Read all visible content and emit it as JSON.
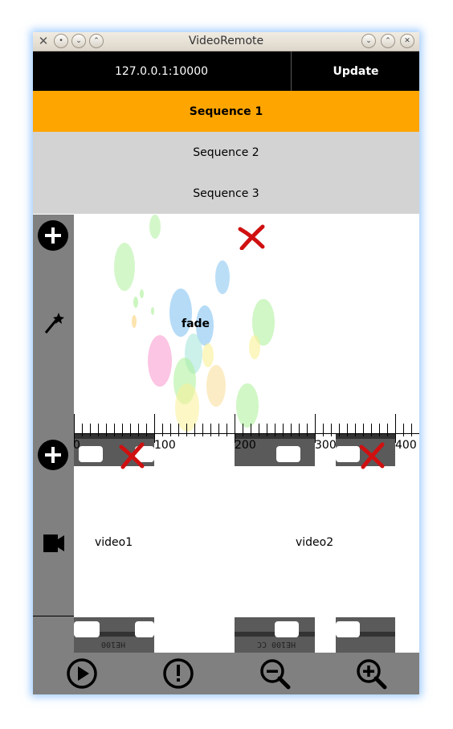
{
  "window": {
    "title": "VideoRemote"
  },
  "connection": {
    "address": "127.0.0.1:10000",
    "update_label": "Update"
  },
  "sequences": [
    {
      "label": "Sequence 1",
      "active": true
    },
    {
      "label": "Sequence 2",
      "active": false
    },
    {
      "label": "Sequence 3",
      "active": false
    }
  ],
  "effects": {
    "label": "fade"
  },
  "ruler": {
    "labels": [
      "0",
      "100",
      "200",
      "300",
      "400"
    ]
  },
  "videos": [
    {
      "label": "video1",
      "film_code": "HE100"
    },
    {
      "label": "video2",
      "film_code": "HE100 CC"
    }
  ],
  "icons": {
    "add_effect": "plus-circle-icon",
    "magic_wand": "magic-wand-icon",
    "add_video": "plus-circle-icon",
    "camera": "video-camera-icon",
    "play": "play-icon",
    "alert": "alert-icon",
    "zoom_out": "zoom-out-icon",
    "zoom_in": "zoom-in-icon",
    "delete": "delete-x-icon"
  },
  "colors": {
    "active_sequence": "#ffa500",
    "inactive_sequence": "#d3d3d3",
    "sidebar": "#808080",
    "topbar": "#000000"
  }
}
